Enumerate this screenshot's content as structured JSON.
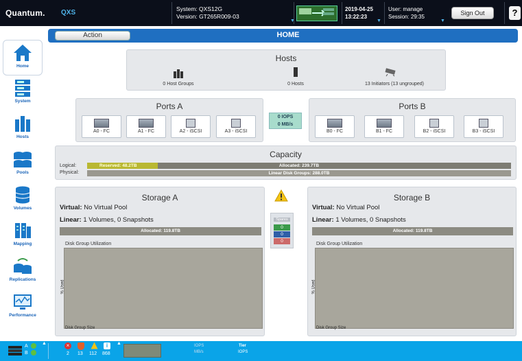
{
  "topbar": {
    "brand": "Quantum.",
    "product": "QXS",
    "system": "System: QXS12G",
    "version": "Version: GT265R009-03",
    "date": "2019-04-25",
    "time": "13:22:23",
    "user": "User: manage",
    "session": "Session: 29:35",
    "signout_label": "Sign Out",
    "help_label": "?"
  },
  "sidebar": {
    "items": [
      {
        "label": "Home",
        "icon": "home-icon"
      },
      {
        "label": "System",
        "icon": "system-icon"
      },
      {
        "label": "Hosts",
        "icon": "hosts-icon"
      },
      {
        "label": "Pools",
        "icon": "pools-icon"
      },
      {
        "label": "Volumes",
        "icon": "volumes-icon"
      },
      {
        "label": "Mapping",
        "icon": "mapping-icon"
      },
      {
        "label": "Replications",
        "icon": "replications-icon"
      },
      {
        "label": "Performance",
        "icon": "performance-icon"
      }
    ]
  },
  "header": {
    "action_label": "Action",
    "title": "HOME"
  },
  "hosts": {
    "title": "Hosts",
    "groups": "0 Host Groups",
    "hosts": "0 Hosts",
    "initiators": "13 Initiators (13 ungrouped)"
  },
  "ports_a": {
    "title": "Ports A",
    "ports": [
      "A0 - FC",
      "A1 - FC",
      "A2 - iSCSI",
      "A3 - iSCSI"
    ]
  },
  "ports_b": {
    "title": "Ports B",
    "ports": [
      "B0 - FC",
      "B1 - FC",
      "B2 - iSCSI",
      "B3 - iSCSI"
    ]
  },
  "io": {
    "iops": "0 IOPS",
    "mbs": "0 MB/s"
  },
  "capacity": {
    "title": "Capacity",
    "logical_label": "Logical:",
    "physical_label": "Physical:",
    "reserved": "Reserved: 48.2TB",
    "allocated": "Allocated: 239.7TB",
    "linear": "Linear Disk Groups: 288.0TB",
    "reserved_fraction": 0.167
  },
  "storage_a": {
    "title": "Storage A",
    "virtual_label": "Virtual:",
    "virtual": "No Virtual Pool",
    "linear_label": "Linear:",
    "linear": "1 Volumes, 0 Snapshots",
    "allocated": "Allocated: 119.8TB",
    "chart_title": "Disk Group Utilization",
    "ylabel": "% Used",
    "xlabel": "Disk Group Size"
  },
  "storage_b": {
    "title": "Storage B",
    "virtual_label": "Virtual:",
    "virtual": "No Virtual Pool",
    "linear_label": "Linear:",
    "linear": "1 Volumes, 0 Snapshots",
    "allocated": "Allocated: 119.8TB",
    "chart_title": "Disk Group Utilization",
    "ylabel": "% Used",
    "xlabel": "Disk Group Size"
  },
  "spares": {
    "title": "Spares",
    "values": [
      "0",
      "0",
      "0"
    ],
    "colors": [
      "#3a9a4a",
      "#2e5fa8",
      "#cc6a6a"
    ]
  },
  "footer": {
    "ctrl_a": "A",
    "ctrl_b": "B",
    "counts": [
      "2",
      "13",
      "112",
      "868"
    ],
    "io_label": "IOPS",
    "io_sub": "MB/s",
    "tier_label": "Tier",
    "tier_sub": "IOPS"
  }
}
